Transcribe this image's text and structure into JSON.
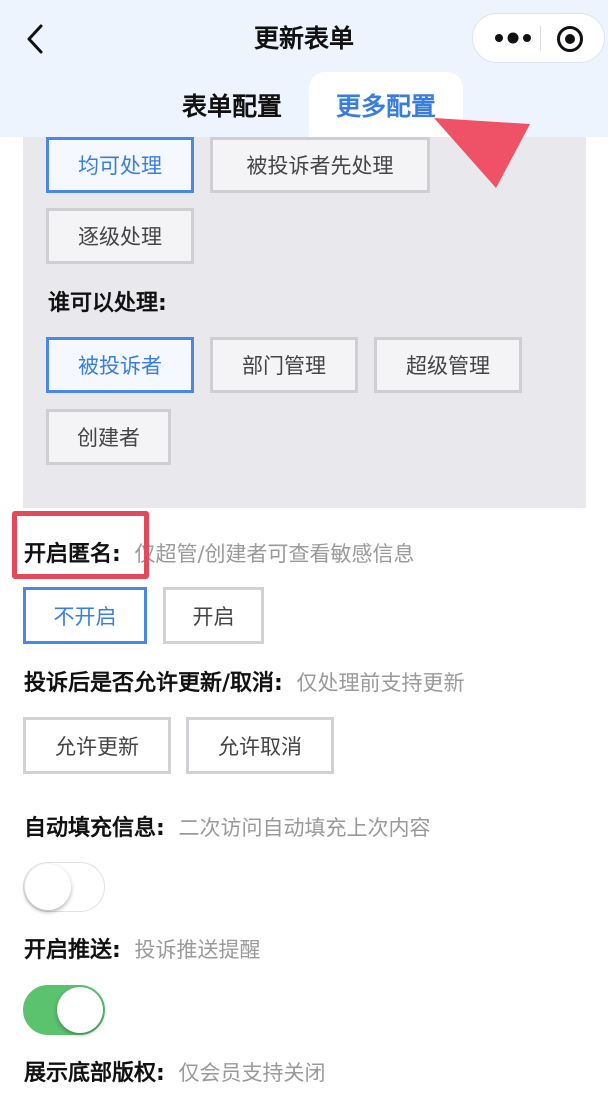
{
  "header": {
    "title": "更新表单",
    "tabs": [
      {
        "label": "表单配置",
        "active": false
      },
      {
        "label": "更多配置",
        "active": true
      }
    ]
  },
  "colors": {
    "accent": "#3a7de0",
    "annotation_red": "#e24a5b",
    "toggle_on": "#5bc26e"
  },
  "icons": [
    "back-arrow-icon",
    "more-dots-icon",
    "target-icon"
  ],
  "handling_mode": {
    "options": [
      "均可处理",
      "被投诉者先处理",
      "逐级处理"
    ],
    "selected": "均可处理"
  },
  "who_can_handle": {
    "label": "谁可以处理:",
    "options": [
      "被投诉者",
      "部门管理",
      "超级管理",
      "创建者"
    ],
    "selected": "被投诉者"
  },
  "anonymous": {
    "label": "开启匿名:",
    "hint": "仅超管/创建者可查看敏感信息",
    "options": [
      "不开启",
      "开启"
    ],
    "selected": "不开启"
  },
  "allow_update": {
    "label": "投诉后是否允许更新/取消:",
    "hint": "仅处理前支持更新",
    "options": [
      "允许更新",
      "允许取消"
    ]
  },
  "autofill": {
    "label": "自动填充信息:",
    "hint": "二次访问自动填充上次内容",
    "enabled": false
  },
  "push": {
    "label": "开启推送:",
    "hint": "投诉推送提醒",
    "enabled": true
  },
  "copyright": {
    "label": "展示底部版权:",
    "hint": "仅会员支持关闭"
  }
}
